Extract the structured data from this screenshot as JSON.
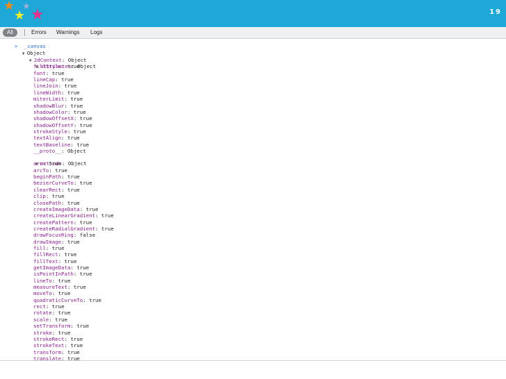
{
  "header": {
    "slide_number": "19",
    "star_colors": [
      "#f08c1e",
      "#9bb2d6",
      "#f2ee2a",
      "#e6308a"
    ],
    "bar_color": "#1ea8d8"
  },
  "toolbar": {
    "tabs": [
      "All",
      "Errors",
      "Warnings",
      "Logs"
    ],
    "active_tab": "All"
  },
  "console": {
    "prompt_symbol": ">",
    "command": "_canvas",
    "root_label": "Object",
    "context_key": "2dContext",
    "context_value": "Object",
    "attributes_key": "attributes",
    "attributes_value": "Object",
    "attributes": [
      {
        "key": "fillStyle",
        "value": "true"
      },
      {
        "key": "font",
        "value": "true"
      },
      {
        "key": "lineCap",
        "value": "true"
      },
      {
        "key": "lineJoin",
        "value": "true"
      },
      {
        "key": "lineWidth",
        "value": "true"
      },
      {
        "key": "miterLimit",
        "value": "true"
      },
      {
        "key": "shadowBlur",
        "value": "true"
      },
      {
        "key": "shadowColor",
        "value": "true"
      },
      {
        "key": "shadowOffsetX",
        "value": "true"
      },
      {
        "key": "shadowOffsetY",
        "value": "true"
      },
      {
        "key": "strokeStyle",
        "value": "true"
      },
      {
        "key": "textAlign",
        "value": "true"
      },
      {
        "key": "textBaseline",
        "value": "true"
      },
      {
        "key": "__proto__",
        "value": "Object"
      }
    ],
    "methods_key": "methods",
    "methods_value": "Object",
    "methods": [
      {
        "key": "arc",
        "value": "true"
      },
      {
        "key": "arcTo",
        "value": "true"
      },
      {
        "key": "beginPath",
        "value": "true"
      },
      {
        "key": "bezierCurveTo",
        "value": "true"
      },
      {
        "key": "clearRect",
        "value": "true"
      },
      {
        "key": "clip",
        "value": "true"
      },
      {
        "key": "closePath",
        "value": "true"
      },
      {
        "key": "createImageData",
        "value": "true"
      },
      {
        "key": "createLinearGradient",
        "value": "true"
      },
      {
        "key": "createPattern",
        "value": "true"
      },
      {
        "key": "createRadialGradient",
        "value": "true"
      },
      {
        "key": "drawFocusRing",
        "value": "false"
      },
      {
        "key": "drawImage",
        "value": "true"
      },
      {
        "key": "fill",
        "value": "true"
      },
      {
        "key": "fillRect",
        "value": "true"
      },
      {
        "key": "fillText",
        "value": "true"
      },
      {
        "key": "getImageData",
        "value": "true"
      },
      {
        "key": "isPointInPath",
        "value": "true"
      },
      {
        "key": "lineTo",
        "value": "true"
      },
      {
        "key": "measureText",
        "value": "true"
      },
      {
        "key": "moveTo",
        "value": "true"
      },
      {
        "key": "quadraticCurveTo",
        "value": "true"
      },
      {
        "key": "rect",
        "value": "true"
      },
      {
        "key": "rotate",
        "value": "true"
      },
      {
        "key": "scale",
        "value": "true"
      },
      {
        "key": "setTransform",
        "value": "true"
      },
      {
        "key": "stroke",
        "value": "true"
      },
      {
        "key": "strokeRect",
        "value": "true"
      },
      {
        "key": "strokeText",
        "value": "true"
      },
      {
        "key": "transform",
        "value": "true"
      },
      {
        "key": "translate",
        "value": "true"
      }
    ]
  }
}
